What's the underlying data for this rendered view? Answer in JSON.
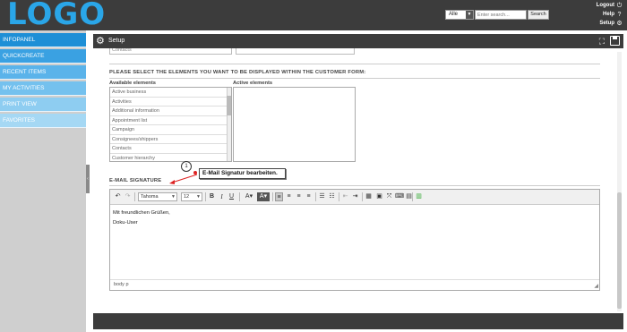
{
  "brand": {
    "logo_text": "LOGO",
    "accent": "#2aa6e8",
    "topbar_color": "#3c3c3c"
  },
  "header": {
    "search_scope": "Alle",
    "search_placeholder": "Enter search...",
    "search_button": "Search",
    "links": [
      "Logout",
      "Help",
      "Setup"
    ]
  },
  "sidebar": {
    "items": [
      {
        "label": "INFOPANEL",
        "color": "#1e8fd6"
      },
      {
        "label": "QUICKCREATE",
        "color": "#3aa1e2"
      },
      {
        "label": "RECENT ITEMS",
        "color": "#5ab3ea"
      },
      {
        "label": "MY ACTIVITIES",
        "color": "#74c1ee"
      },
      {
        "label": "PRINT VIEW",
        "color": "#8ecdf1"
      },
      {
        "label": "FAVORITES",
        "color": "#a5d8f4"
      }
    ]
  },
  "panel": {
    "title": "Setup"
  },
  "form": {
    "contacts_partial": "Contacts",
    "elements_heading": "PLEASE SELECT THE ELEMENTS YOU WANT TO BE DISPLAYED WITHIN THE CUSTOMER FORM:",
    "available_label": "Available elements",
    "active_label": "Active elements",
    "available_items": [
      "Active business",
      "Activities",
      "Additional information",
      "Appointment list",
      "Campaign",
      "Consignees/shippers",
      "Contacts",
      "Customer hierarchy"
    ],
    "signature_heading": "E-MAIL SIGNATURE"
  },
  "callout": {
    "number": "1",
    "text": "E-Mail Signatur bearbeiten."
  },
  "editor": {
    "font": "Tahoma",
    "size": "12",
    "content_lines": [
      "Mit freundlichen Grüßen,",
      "Doku-User"
    ],
    "status_path": "body   p"
  }
}
